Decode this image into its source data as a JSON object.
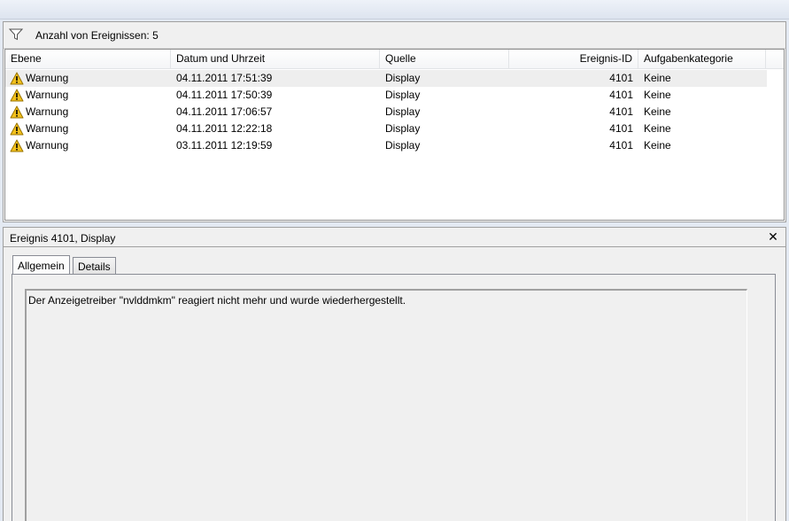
{
  "filter_bar": {
    "icon": "filter-funnel-icon",
    "text": "Anzahl von Ereignissen: 5"
  },
  "columns": [
    {
      "label": "Ebene"
    },
    {
      "label": "Datum und Uhrzeit"
    },
    {
      "label": "Quelle"
    },
    {
      "label": "Ereignis-ID"
    },
    {
      "label": "Aufgabenkategorie"
    }
  ],
  "events": [
    {
      "level": "Warnung",
      "datetime": "04.11.2011 17:51:39",
      "source": "Display",
      "event_id": "4101",
      "category": "Keine",
      "selected": true
    },
    {
      "level": "Warnung",
      "datetime": "04.11.2011 17:50:39",
      "source": "Display",
      "event_id": "4101",
      "category": "Keine",
      "selected": false
    },
    {
      "level": "Warnung",
      "datetime": "04.11.2011 17:06:57",
      "source": "Display",
      "event_id": "4101",
      "category": "Keine",
      "selected": false
    },
    {
      "level": "Warnung",
      "datetime": "04.11.2011 12:22:18",
      "source": "Display",
      "event_id": "4101",
      "category": "Keine",
      "selected": false
    },
    {
      "level": "Warnung",
      "datetime": "03.11.2011 12:19:59",
      "source": "Display",
      "event_id": "4101",
      "category": "Keine",
      "selected": false
    }
  ],
  "detail": {
    "title": "Ereignis 4101, Display",
    "close_icon": "close-icon",
    "tabs": [
      {
        "label": "Allgemein",
        "active": true
      },
      {
        "label": "Details",
        "active": false
      }
    ],
    "message": "Der Anzeigetreiber \"nvlddmkm\" reagiert nicht mehr und wurde wiederhergestellt."
  },
  "colors": {
    "warning_yellow": "#f2c01b",
    "selected_row": "#eeeeee",
    "panel_border": "#a0a0a0"
  }
}
